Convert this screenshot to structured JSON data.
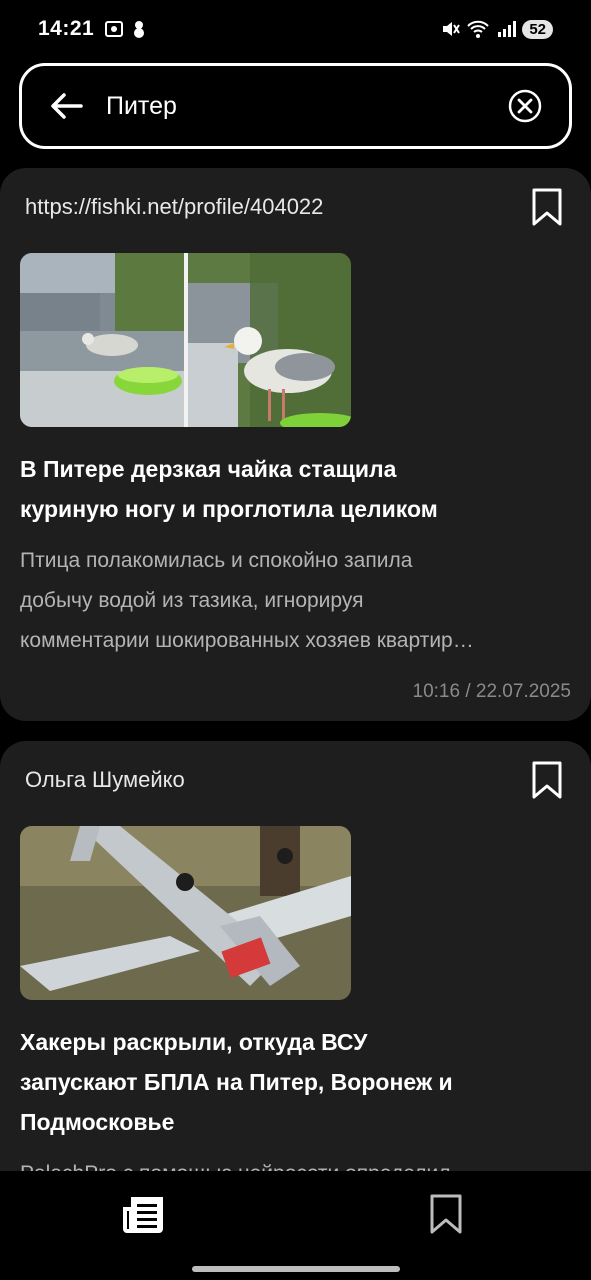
{
  "status_bar": {
    "time": "14:21",
    "battery": "52",
    "icons_left": [
      "screenshot-icon",
      "notification-icon"
    ],
    "icons_right": [
      "mute-icon",
      "wifi-icon",
      "signal-icon"
    ]
  },
  "search": {
    "value": "Питер",
    "back_icon": "arrow-left-icon",
    "clear_icon": "clear-circle-icon"
  },
  "articles": [
    {
      "source": "https://fishki.net/profile/404022",
      "title_line1": "В Питере дерзкая чайка стащила",
      "title_line2": "куриную ногу и проглотила целиком",
      "desc_line1": "Птица полакомилась и спокойно запила",
      "desc_line2": "добычу водой из тазика, игнорируя",
      "desc_line3": "комментарии шокированных хозяев квартир…",
      "date": "10:16 / 22.07.2025",
      "image": "seagull-photo"
    },
    {
      "source": "Ольга Шумейко",
      "title_line1": "Хакеры раскрыли, откуда ВСУ",
      "title_line2": "запускают БПЛА на Питер, Воронеж и",
      "title_line3": "Подмосковье",
      "desc_line1": "PalachPro с помощью нейросети определил",
      "image": "drone-wreck-photo"
    }
  ],
  "bottom_nav": {
    "news_icon": "news-feed-icon",
    "bookmarks_icon": "bookmark-icon"
  }
}
